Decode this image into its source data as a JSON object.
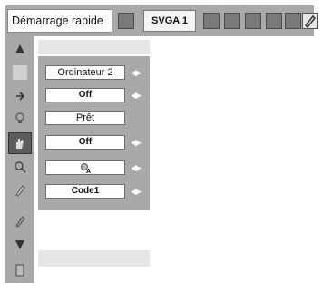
{
  "toolbar": {
    "mode_label": "Démarrage rapide",
    "signal_label": "SVGA 1",
    "icons": [
      "image-icon",
      "computer-icon",
      "people-icon",
      "camera-icon",
      "grid-icon",
      "speaker-icon",
      "pencil-icon"
    ]
  },
  "sidebar": {
    "icons": [
      "up-arrow-icon",
      "keyboard-icon",
      "input-icon",
      "lamp-icon",
      "hand-icon",
      "search-icon",
      "pencil-icon",
      "brush-icon",
      "down-arrow-icon",
      "door-icon"
    ]
  },
  "menu": {
    "rows": [
      {
        "value": "Ordinateur 2",
        "arrows": true
      },
      {
        "value": "Off",
        "arrows": true
      },
      {
        "value": "Prêt",
        "arrows": false
      },
      {
        "value": "Off",
        "arrows": true
      },
      {
        "value": "",
        "arrows": true
      },
      {
        "value": "Code1",
        "arrows": true
      }
    ]
  }
}
